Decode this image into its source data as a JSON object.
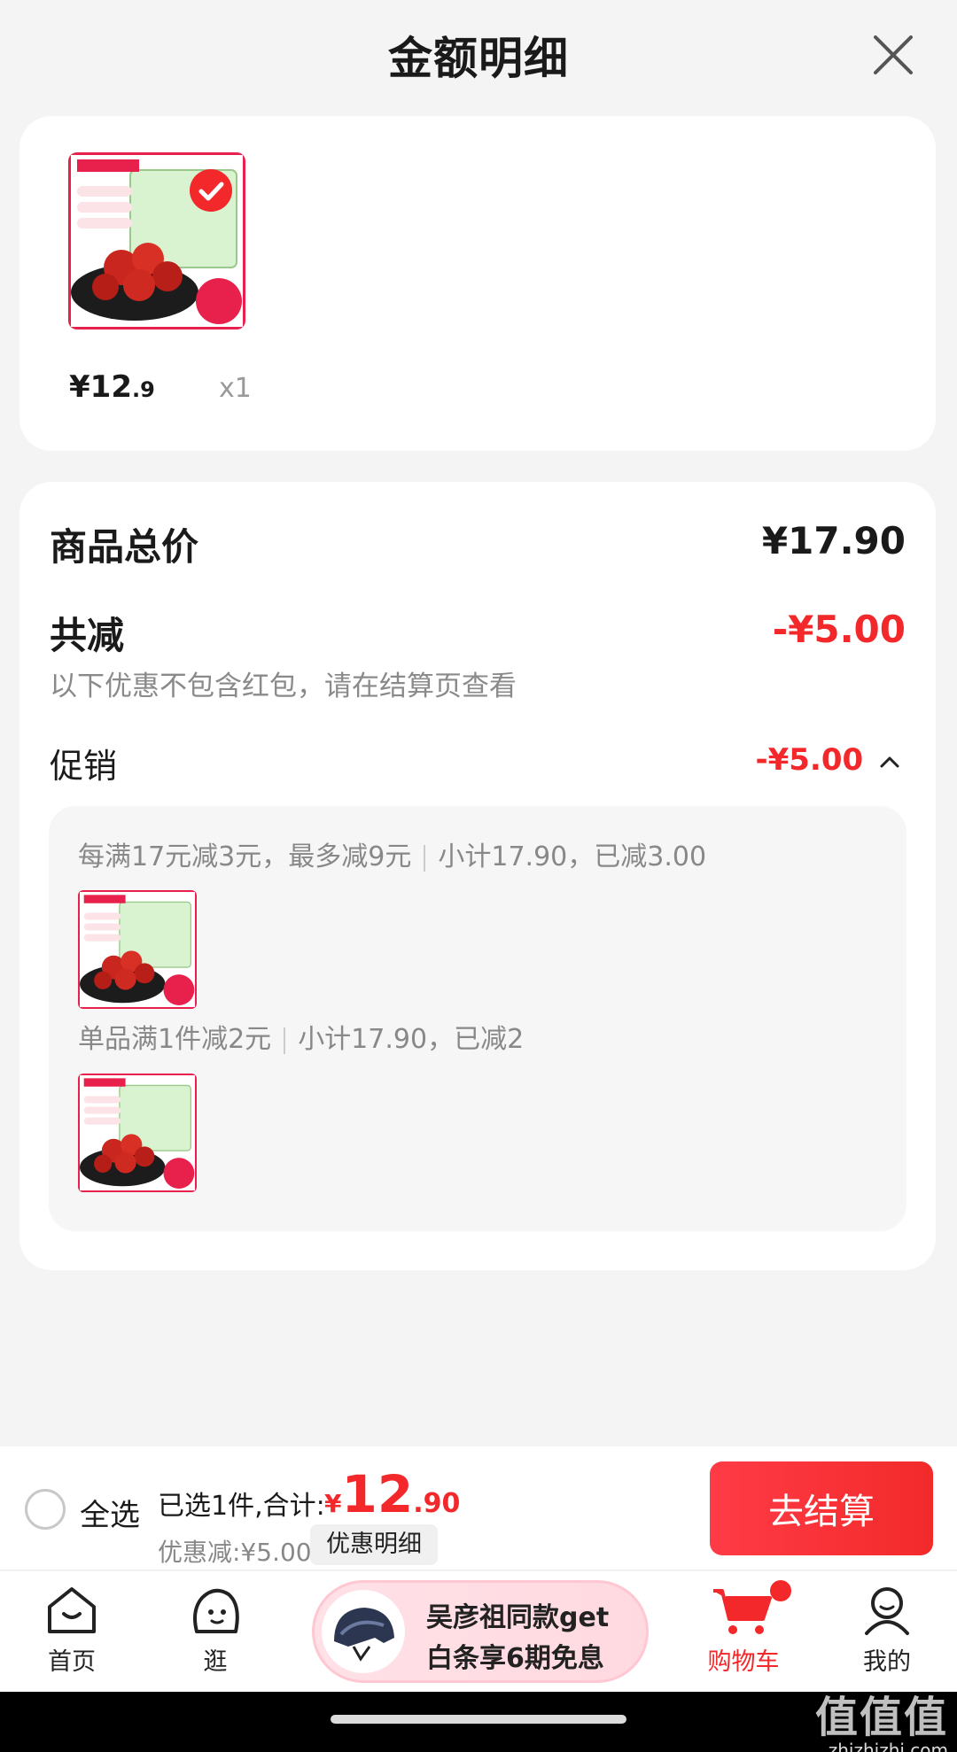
{
  "header": {
    "title": "金额明细"
  },
  "product": {
    "price_int": "¥12",
    "price_dec": ".9",
    "qty": "x1"
  },
  "summary": {
    "total_label": "商品总价",
    "total_amount": "¥17.90",
    "discount_label": "共减",
    "discount_amount": "-¥5.00",
    "note": "以下优惠不包含红包，请在结算页查看",
    "promo_label": "促销",
    "promo_amount": "-¥5.00",
    "promos": [
      {
        "rule": "每满17元减3元，最多减9元",
        "subtotal": "小计17.90，已减3.00"
      },
      {
        "rule": "单品满1件减2元",
        "subtotal": "小计17.90，已减2"
      }
    ]
  },
  "checkout": {
    "select_all": "全选",
    "selected": "已选1件,合计:",
    "currency": "¥",
    "total_int": "12",
    "total_dec": ".90",
    "discount": "优惠减:¥5.00",
    "detail_chip": "优惠明细",
    "button": "去结算"
  },
  "nav": {
    "home": "首页",
    "browse": "逛",
    "ad_line1": "吴彦祖同款get",
    "ad_line2": "白条享6期免息",
    "cart": "购物车",
    "me": "我的"
  },
  "watermark": {
    "logo": "值值值",
    "url": "zhizhizhi.com"
  },
  "colors": {
    "accent": "#f2282b",
    "background": "#f4f4f5"
  }
}
